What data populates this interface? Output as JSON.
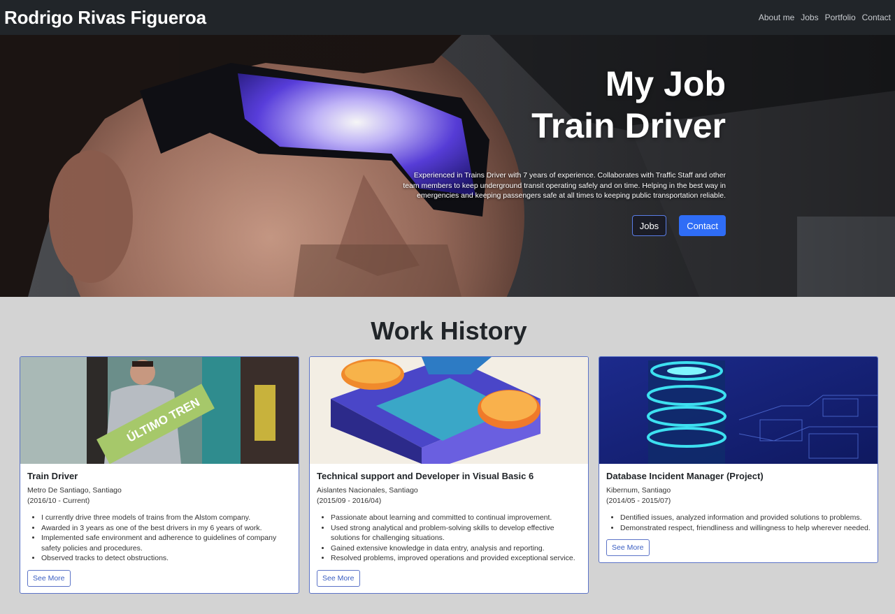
{
  "navbar": {
    "brand": "Rodrigo Rivas Figueroa",
    "links": [
      "About me",
      "Jobs",
      "Portfolio",
      "Contact"
    ]
  },
  "hero": {
    "title_line1": "My Job",
    "title_line2": "Train Driver",
    "description": "Experienced in Trains Driver with 7 years of experience. Collaborates with Traffic Staff and other team members to keep underground transit operating safely and on time. Helping in the best way in emergencies and keeping passengers safe at all times to keeping public transportation reliable.",
    "button_jobs": "Jobs",
    "button_contact": "Contact",
    "accent_color": "#2f6df6"
  },
  "work_history": {
    "title": "Work History",
    "see_more_label": "See More",
    "cards": [
      {
        "title": "Train Driver",
        "company": "Metro De Santiago, Santiago",
        "dates": "(2016/10 - Current)",
        "image_sign_text": "ÚLTIMO TREN",
        "bullets": [
          "I currently drive three models of trains from the Alstom company.",
          "Awarded in 3 years as one of the best drivers in my 6 years of work.",
          "Implemented safe environment and adherence to guidelines of company safety policies and procedures.",
          "Observed tracks to detect obstructions."
        ]
      },
      {
        "title": "Technical support and Developer in Visual Basic 6",
        "company": "Aislantes Nacionales, Santiago",
        "dates": "(2015/09 - 2016/04)",
        "bullets": [
          "Passionate about learning and committed to continual improvement.",
          "Used strong analytical and problem-solving skills to develop effective solutions for challenging situations.",
          "Gained extensive knowledge in data entry, analysis and reporting.",
          "Resolved problems, improved operations and provided exceptional service."
        ]
      },
      {
        "title": "Database Incident Manager (Project)",
        "company": "Kibernum, Santiago",
        "dates": "(2014/05 - 2015/07)",
        "bullets": [
          "Dentified issues, analyzed information and provided solutions to problems.",
          "Demonstrated respect, friendliness and willingness to help wherever needed."
        ]
      }
    ]
  }
}
